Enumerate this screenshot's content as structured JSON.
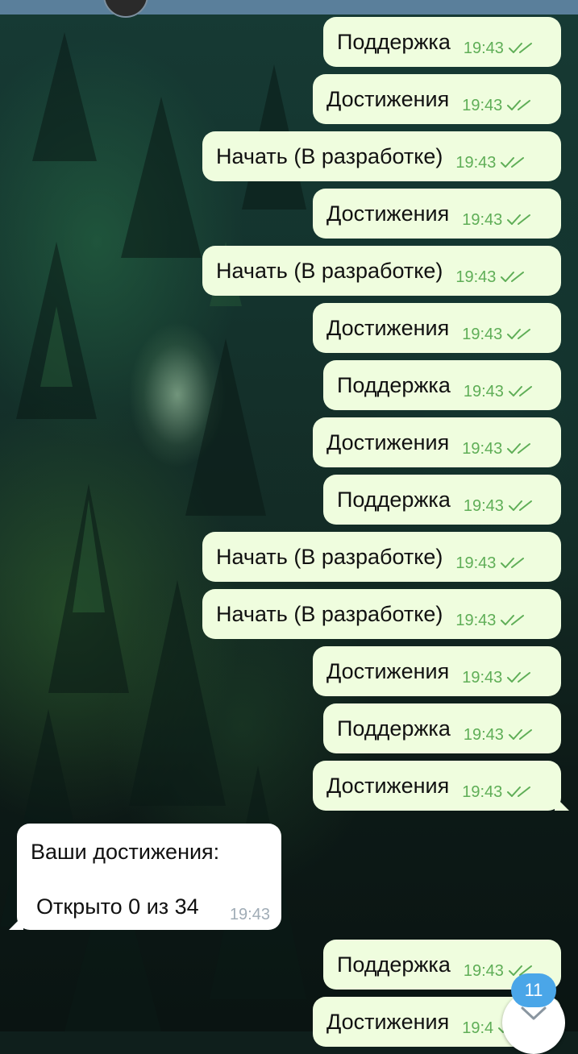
{
  "header": {
    "avatar": "contact-avatar"
  },
  "messages": [
    {
      "dir": "out",
      "text": "Поддержка",
      "time": "19:43",
      "status": "read"
    },
    {
      "dir": "out",
      "text": "Достижения",
      "time": "19:43",
      "status": "read"
    },
    {
      "dir": "out",
      "text": "Начать (В разработке)",
      "time": "19:43",
      "status": "read"
    },
    {
      "dir": "out",
      "text": "Достижения",
      "time": "19:43",
      "status": "read"
    },
    {
      "dir": "out",
      "text": "Начать (В разработке)",
      "time": "19:43",
      "status": "read"
    },
    {
      "dir": "out",
      "text": "Достижения",
      "time": "19:43",
      "status": "read"
    },
    {
      "dir": "out",
      "text": "Поддержка",
      "time": "19:43",
      "status": "read"
    },
    {
      "dir": "out",
      "text": "Достижения",
      "time": "19:43",
      "status": "read"
    },
    {
      "dir": "out",
      "text": "Поддержка",
      "time": "19:43",
      "status": "read"
    },
    {
      "dir": "out",
      "text": "Начать (В разработке)",
      "time": "19:43",
      "status": "read"
    },
    {
      "dir": "out",
      "text": "Начать (В разработке)",
      "time": "19:43",
      "status": "read"
    },
    {
      "dir": "out",
      "text": "Достижения",
      "time": "19:43",
      "status": "read"
    },
    {
      "dir": "out",
      "text": "Поддержка",
      "time": "19:43",
      "status": "read"
    },
    {
      "dir": "out",
      "text": "Достижения",
      "time": "19:43",
      "status": "read"
    },
    {
      "dir": "in",
      "line1": "Ваши достижения:",
      "line2": "Открыто 0 из 34",
      "time": "19:43"
    },
    {
      "dir": "out",
      "text": "Поддержка",
      "time": "19:43",
      "status": "read"
    },
    {
      "dir": "out",
      "text": "Достижения",
      "time": "19:4",
      "status": "read"
    }
  ],
  "unread_badge": "11",
  "icons": {
    "read_receipt": "double-check-icon",
    "scroll_down": "chevron-down-icon"
  },
  "colors": {
    "outgoing_bubble": "#effdde",
    "incoming_bubble": "#ffffff",
    "outgoing_time": "#5fae57",
    "incoming_time": "#a0acb6",
    "badge": "#4aa6e8",
    "header": "#5a7f9b"
  }
}
